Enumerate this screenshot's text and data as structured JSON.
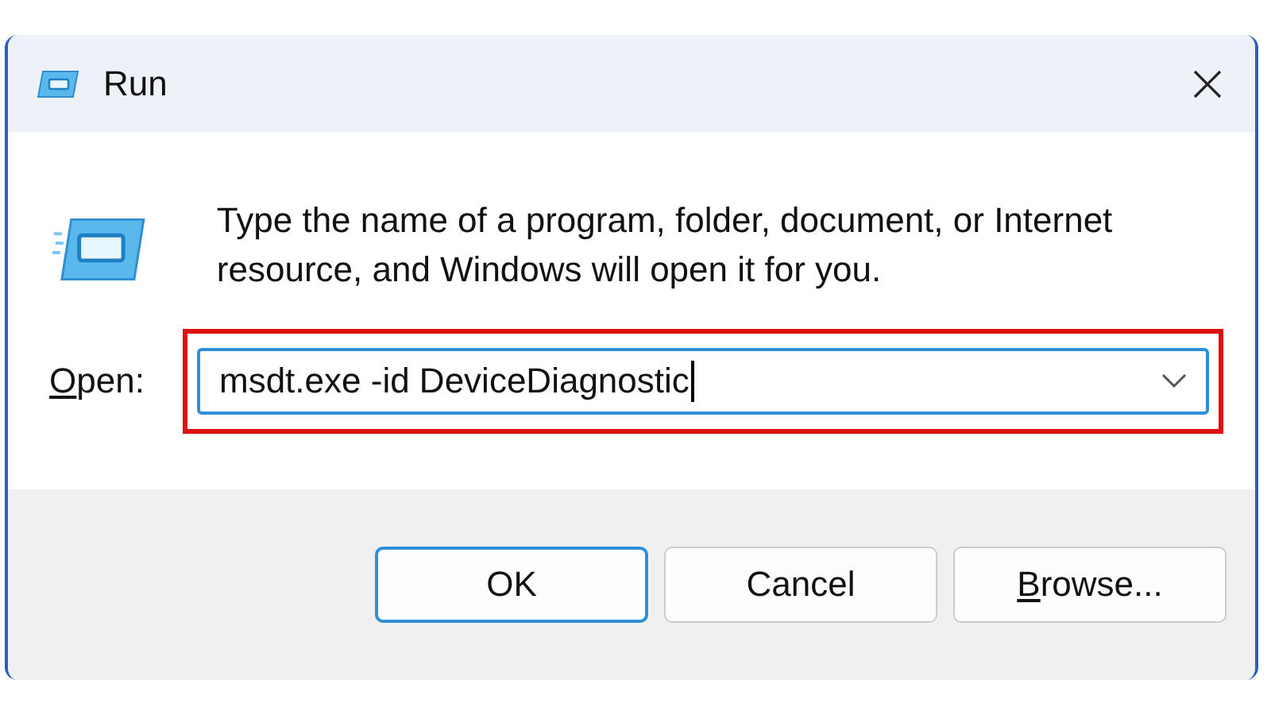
{
  "window": {
    "title": "Run"
  },
  "prompt": "Type the name of a program, folder, document, or Internet resource, and Windows will open it for you.",
  "open_field": {
    "label": "Open:",
    "label_mnemonic": true,
    "value": "msdt.exe -id DeviceDiagnostic",
    "focused": true,
    "highlighted": true
  },
  "buttons": [
    {
      "label": "OK",
      "default": true,
      "mnemonic": false
    },
    {
      "label": "Cancel",
      "default": false,
      "mnemonic": false
    },
    {
      "label": "Browse...",
      "default": false,
      "mnemonic": true
    }
  ]
}
